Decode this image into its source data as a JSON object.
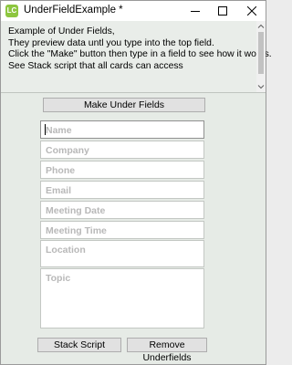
{
  "window": {
    "title": "UnderFieldExample *",
    "app_icon_text": "LC"
  },
  "header": {
    "lines": [
      "Example of Under Fields,",
      "They preview data untl you type into the top field.",
      "Click the  \"Make\" button then type in a field to see how it works.",
      "See Stack script that all cards can access"
    ]
  },
  "buttons": {
    "make": "Make Under Fields",
    "stack_script": "Stack Script",
    "remove": "Remove Underfields"
  },
  "fields": {
    "name": "Name",
    "company": "Company",
    "phone": "Phone",
    "email": "Email",
    "meeting_date": "Meeting Date",
    "meeting_time": "Meeting Time",
    "location": "Location",
    "topic": "Topic"
  },
  "icons": [
    "app-icon",
    "minimize-icon",
    "maximize-icon",
    "close-icon",
    "scroll-up-icon",
    "scroll-down-icon"
  ]
}
